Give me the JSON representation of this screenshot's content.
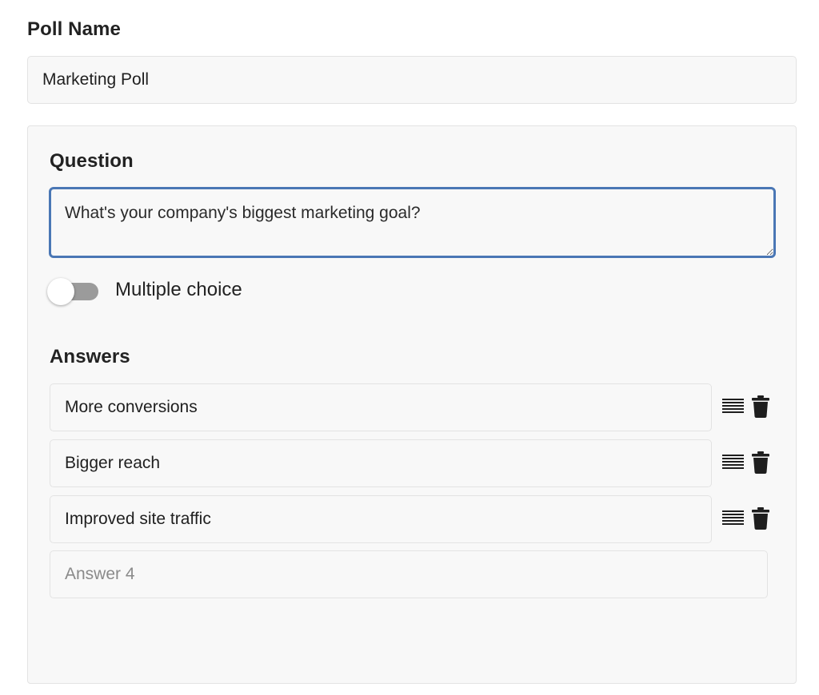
{
  "poll_name": {
    "label": "Poll Name",
    "value": "Marketing Poll"
  },
  "question": {
    "label": "Question",
    "value": "What's your company's biggest marketing goal?"
  },
  "multiple_choice": {
    "label": "Multiple choice",
    "enabled": false
  },
  "answers": {
    "label": "Answers",
    "items": [
      {
        "value": "More conversions"
      },
      {
        "value": "Bigger reach"
      },
      {
        "value": "Improved site traffic"
      }
    ],
    "new_placeholder": "Answer 4"
  },
  "icons": {
    "drag": "drag-handle-icon",
    "delete": "trash-icon"
  },
  "colors": {
    "focus_border": "#4a77b5",
    "toggle_off_track": "#9b9b9b",
    "panel_background": "#f8f8f8"
  }
}
